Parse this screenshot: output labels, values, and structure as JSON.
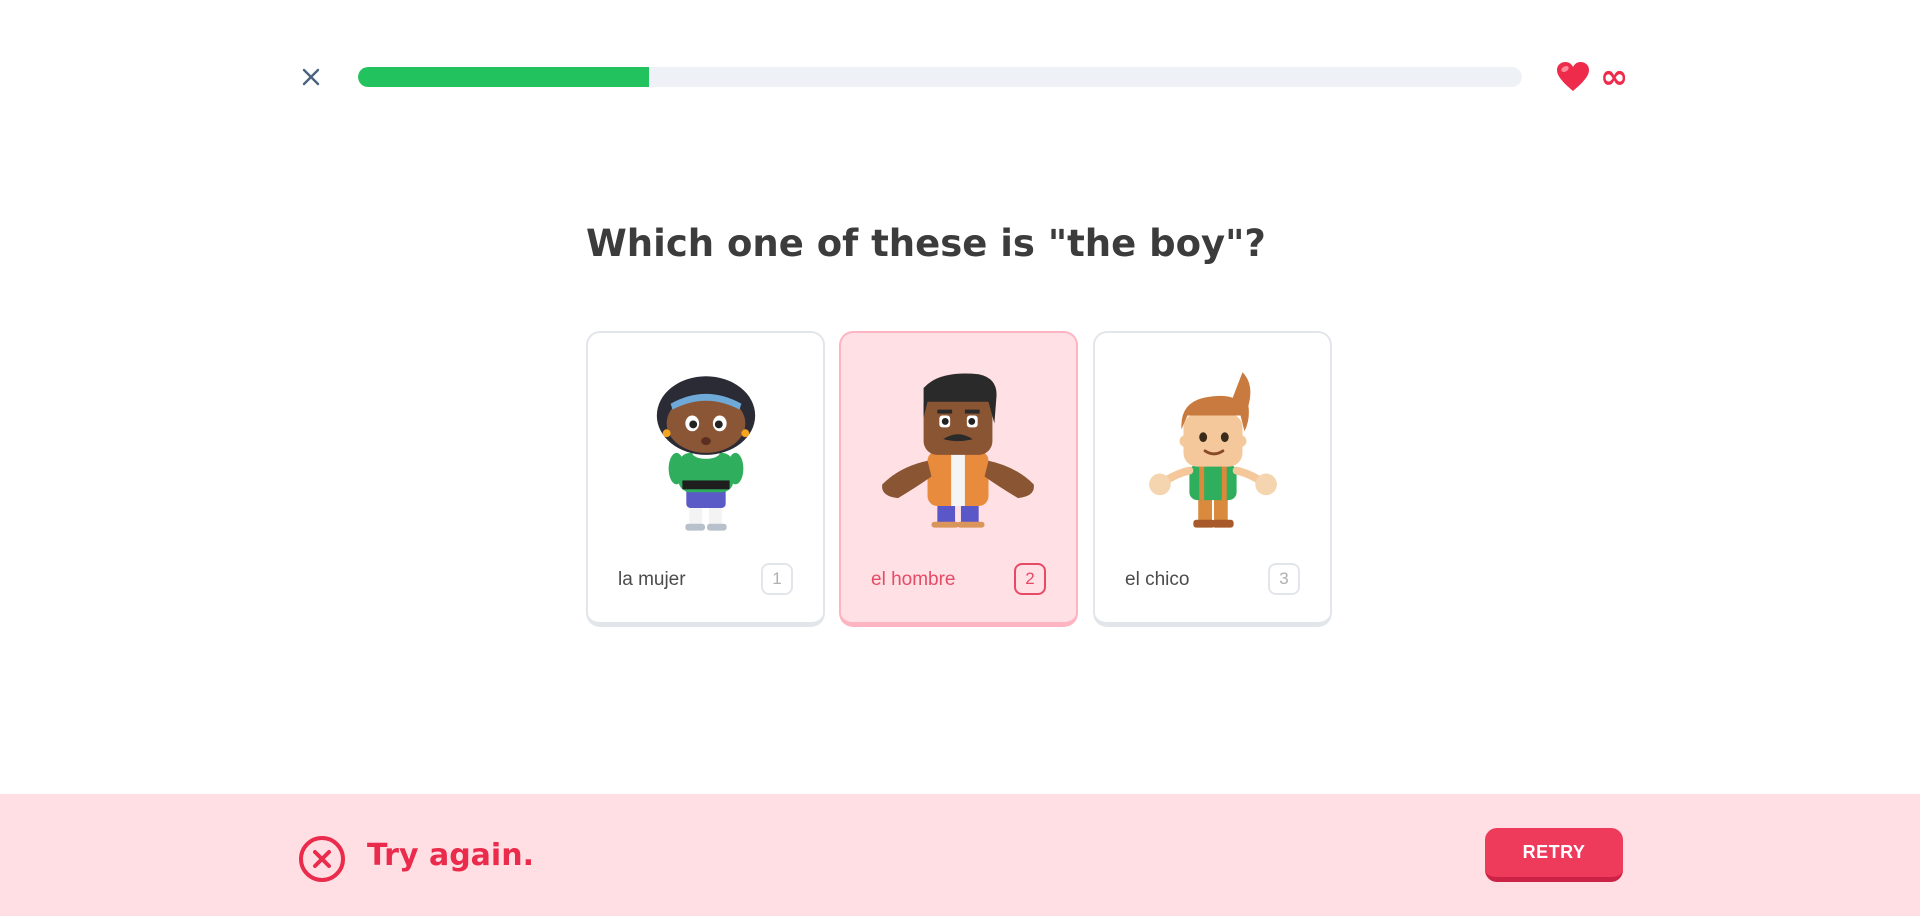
{
  "header": {
    "close_icon": "close-icon",
    "progress_fraction": 0.25,
    "progress_color": "#22c35e",
    "hearts_icon": "heart-icon",
    "hearts_count": "∞"
  },
  "question": {
    "text": "Which one of these is \"the boy\"?"
  },
  "choices": [
    {
      "label": "la mujer",
      "key": "1",
      "selected": false,
      "image": "woman-character"
    },
    {
      "label": "el hombre",
      "key": "2",
      "selected": true,
      "image": "man-character"
    },
    {
      "label": "el chico",
      "key": "3",
      "selected": false,
      "image": "boy-character"
    }
  ],
  "feedback": {
    "icon": "x-circle-icon",
    "message": "Try again.",
    "button_label": "RETRY",
    "status_color": "#ea2b4b"
  }
}
